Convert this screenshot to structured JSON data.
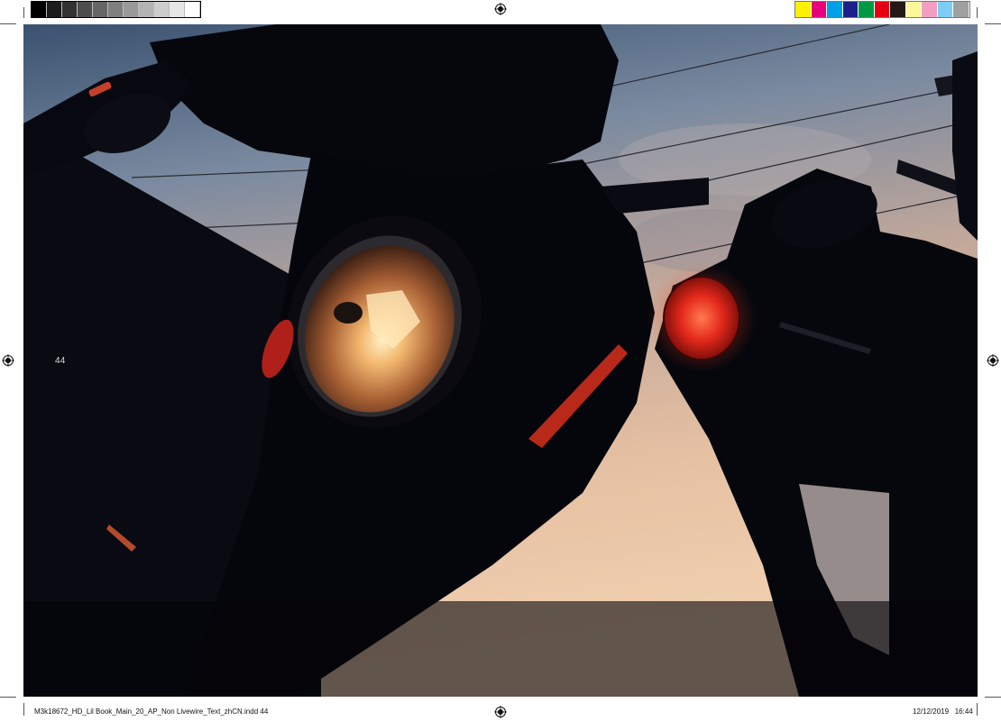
{
  "print_marks": {
    "gray_swatches": [
      "#000000",
      "#1c1c1c",
      "#333333",
      "#4d4d4d",
      "#666666",
      "#7f7f7f",
      "#999999",
      "#b3b3b3",
      "#cccccc",
      "#e6e6e6",
      "#ffffff"
    ],
    "color_swatches": [
      "#fff100",
      "#e5007e",
      "#00a0e9",
      "#1d2088",
      "#009944",
      "#e60012",
      "#231815",
      "#fff799",
      "#f19ec2",
      "#7ecef4",
      "#9fa0a0"
    ]
  },
  "page": {
    "folio": "44"
  },
  "slug": {
    "file_info": "M3k18672_HD_Lil Book_Main_20_AP_Non Livewire_Text_zhCN.indd   44",
    "date": "12/12/2019",
    "time": "16:44"
  }
}
